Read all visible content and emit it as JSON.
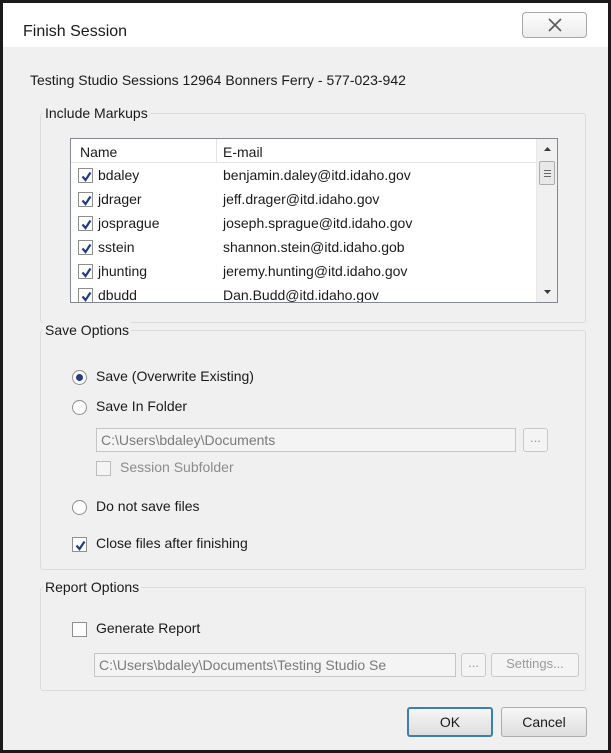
{
  "window": {
    "title": "Finish Session"
  },
  "session_info": "Testing Studio Sessions 12964 Bonners Ferry - 577-023-942",
  "markups": {
    "group_label": "Include Markups",
    "columns": [
      "Name",
      "E-mail"
    ],
    "rows": [
      {
        "name": "bdaley",
        "email": "benjamin.daley@itd.idaho.gov",
        "checked": true
      },
      {
        "name": "jdrager",
        "email": "jeff.drager@itd.idaho.gov",
        "checked": true
      },
      {
        "name": "josprague",
        "email": "joseph.sprague@itd.idaho.gov",
        "checked": true
      },
      {
        "name": "sstein",
        "email": "shannon.stein@itd.idaho.gob",
        "checked": true
      },
      {
        "name": "jhunting",
        "email": "jeremy.hunting@itd.idaho.gov",
        "checked": true
      },
      {
        "name": "dbudd",
        "email": "Dan.Budd@itd.idaho.gov",
        "checked": true
      }
    ]
  },
  "save_options": {
    "group_label": "Save Options",
    "overwrite_label": "Save (Overwrite Existing)",
    "overwrite_selected": true,
    "folder_label": "Save In Folder",
    "folder_selected": false,
    "folder_path": "C:\\Users\\bdaley\\Documents",
    "browse_label": "...",
    "subfolder_label": "Session Subfolder",
    "subfolder_checked": false,
    "no_save_label": "Do not save files",
    "no_save_selected": false,
    "close_files_label": "Close files after finishing",
    "close_files_checked": true
  },
  "report_options": {
    "group_label": "Report Options",
    "generate_label": "Generate Report",
    "generate_checked": false,
    "report_path": "C:\\Users\\bdaley\\Documents\\Testing Studio Se",
    "browse_label": "...",
    "settings_label": "Settings..."
  },
  "buttons": {
    "ok": "OK",
    "cancel": "Cancel"
  }
}
